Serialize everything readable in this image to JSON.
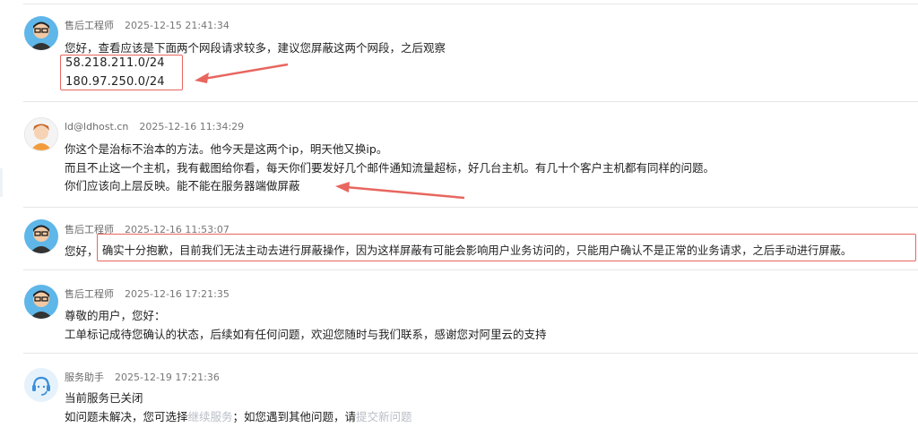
{
  "messages": [
    {
      "sender": "售后工程师",
      "time": "2025-12-15 21:41:34",
      "avatar": "engineer-avatar",
      "lines": [
        "您好，查看应该是下面两个网段请求较多，建议您屏蔽这两个网段，之后观察"
      ],
      "ips": [
        "58.218.211.0/24",
        "180.97.250.0/24"
      ]
    },
    {
      "sender": "ld@ldhost.cn",
      "time": "2025-12-16 11:34:29",
      "avatar": "user-avatar",
      "lines": [
        "你这个是治标不治本的方法。他今天是这两个ip，明天他又换ip。",
        "而且不止这一个主机，我有截图给你看，每天你们要发好几个邮件通知流量超标，好几台主机。有几十个客户主机都有同样的问题。",
        "你们应该向上层反映。能不能在服务器端做屏蔽"
      ]
    },
    {
      "sender": "售后工程师",
      "time": "2025-12-16 11:53:07",
      "avatar": "engineer-avatar",
      "prefix": "您好，",
      "highlighted": "确实十分抱歉，目前我们无法主动去进行屏蔽操作，因为这样屏蔽有可能会影响用户业务访问的，只能用户确认不是正常的业务请求，之后手动进行屏蔽。"
    },
    {
      "sender": "售后工程师",
      "time": "2025-12-16 17:21:35",
      "avatar": "engineer-avatar",
      "lines": [
        "尊敬的用户，您好：",
        "工单标记成待您确认的状态，后续如有任何问题，欢迎您随时与我们联系，感谢您对阿里云的支持"
      ]
    },
    {
      "sender": "服务助手",
      "time": "2025-12-19 17:21:36",
      "avatar": "assistant-avatar",
      "lines": [
        "当前服务已关闭"
      ],
      "closing_prefix": "如问题未解决，您可选择",
      "continue_link": "继续服务",
      "closing_middle": "；如您遇到其他问题，请",
      "new_issue_link": "提交新问题"
    }
  ],
  "colors": {
    "annotation_red": "#e8665f",
    "link_faint": "#b9bec6",
    "separator": "#e6e6e6"
  }
}
